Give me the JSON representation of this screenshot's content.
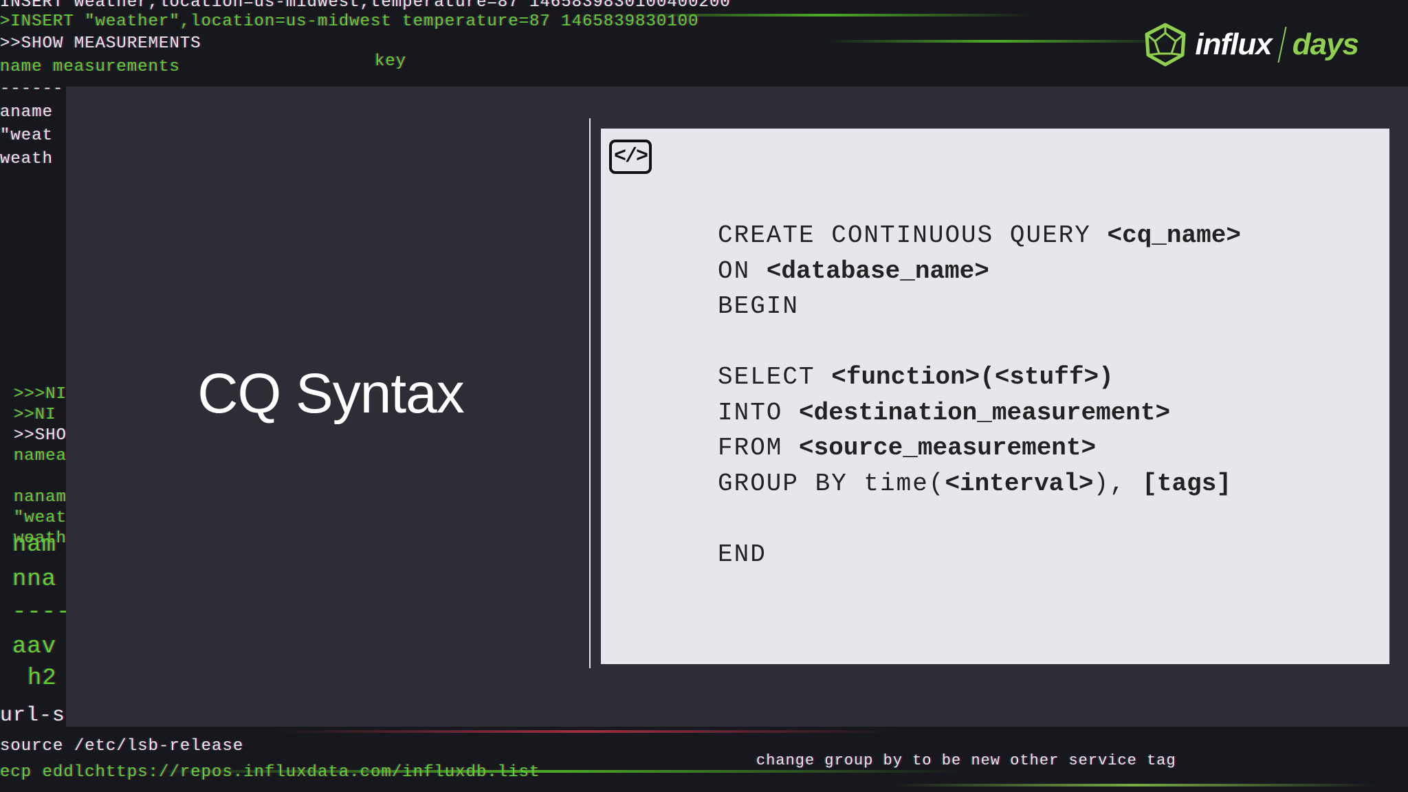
{
  "background_terminal": {
    "lines": [
      "INSERT weather,location=us-midwest,temperature=87 1465839830100400200",
      ">INSERT \"weather\",location=us-midwest temperature=87 1465839830100",
      ">>SHOW MEASUREMENTS",
      "name measurements",
      "key",
      "------",
      "aname",
      "\"weat",
      "weath",
      ">>>NI",
      ">>NI",
      ">>SHO",
      "namea",
      "nanam",
      "\"weat",
      "weath",
      "nam",
      "nna",
      "----",
      "aav",
      "h2",
      "url-s",
      "source /etc/lsb-release",
      "ecp eddlchttps://repos.influxdata.com/influxdb.list",
      "change group by to be new other service tag"
    ],
    "green": "#5bd12a",
    "white": "#e8e8e8"
  },
  "logo": {
    "brand": "influx",
    "suffix": "days",
    "accent_color": "#8fd14f"
  },
  "slide": {
    "title": "CQ Syntax",
    "code_icon_label": "</>",
    "code_lines": [
      [
        {
          "t": "CREATE CONTINUOUS QUERY ",
          "b": false
        },
        {
          "t": "<cq_name>",
          "b": true
        }
      ],
      [
        {
          "t": "ON ",
          "b": false
        },
        {
          "t": "<database_name>",
          "b": true
        }
      ],
      [
        {
          "t": "BEGIN",
          "b": false
        }
      ],
      [],
      [
        {
          "t": "SELECT ",
          "b": false
        },
        {
          "t": "<function>(<stuff>)",
          "b": true
        }
      ],
      [
        {
          "t": "INTO ",
          "b": false
        },
        {
          "t": "<destination_measurement>",
          "b": true
        }
      ],
      [
        {
          "t": "FROM ",
          "b": false
        },
        {
          "t": "<source_measurement>",
          "b": true
        }
      ],
      [
        {
          "t": "GROUP BY time(",
          "b": false
        },
        {
          "t": "<interval>",
          "b": true
        },
        {
          "t": "), ",
          "b": false
        },
        {
          "t": "[tags]",
          "b": true
        }
      ],
      [],
      [
        {
          "t": "END",
          "b": false
        }
      ]
    ]
  },
  "colors": {
    "slide_bg": "#2c2d35",
    "code_panel_bg": "#e6e7ec",
    "title_color": "#ffffff"
  }
}
